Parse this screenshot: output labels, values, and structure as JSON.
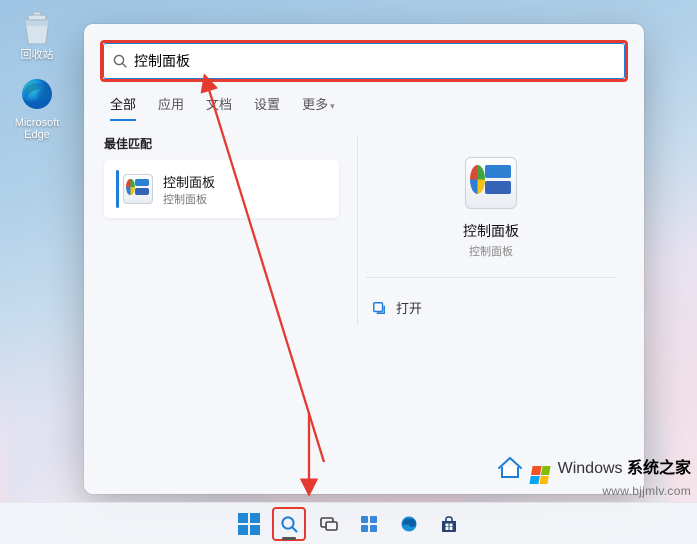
{
  "desktop": {
    "recycle_bin_label": "回收站",
    "edge_label": "Microsoft\nEdge"
  },
  "search": {
    "query": "控制面板",
    "tabs": {
      "all": "全部",
      "apps": "应用",
      "documents": "文档",
      "settings": "设置",
      "more": "更多"
    },
    "best_match_heading": "最佳匹配",
    "best_match": {
      "title": "控制面板",
      "subtitle": "控制面板"
    },
    "preview": {
      "title": "控制面板",
      "subtitle": "控制面板",
      "open": "打开"
    }
  },
  "watermark": {
    "brand_prefix": "Windows ",
    "brand_suffix": "系统之家",
    "url": "www.bjjmlv.com"
  }
}
